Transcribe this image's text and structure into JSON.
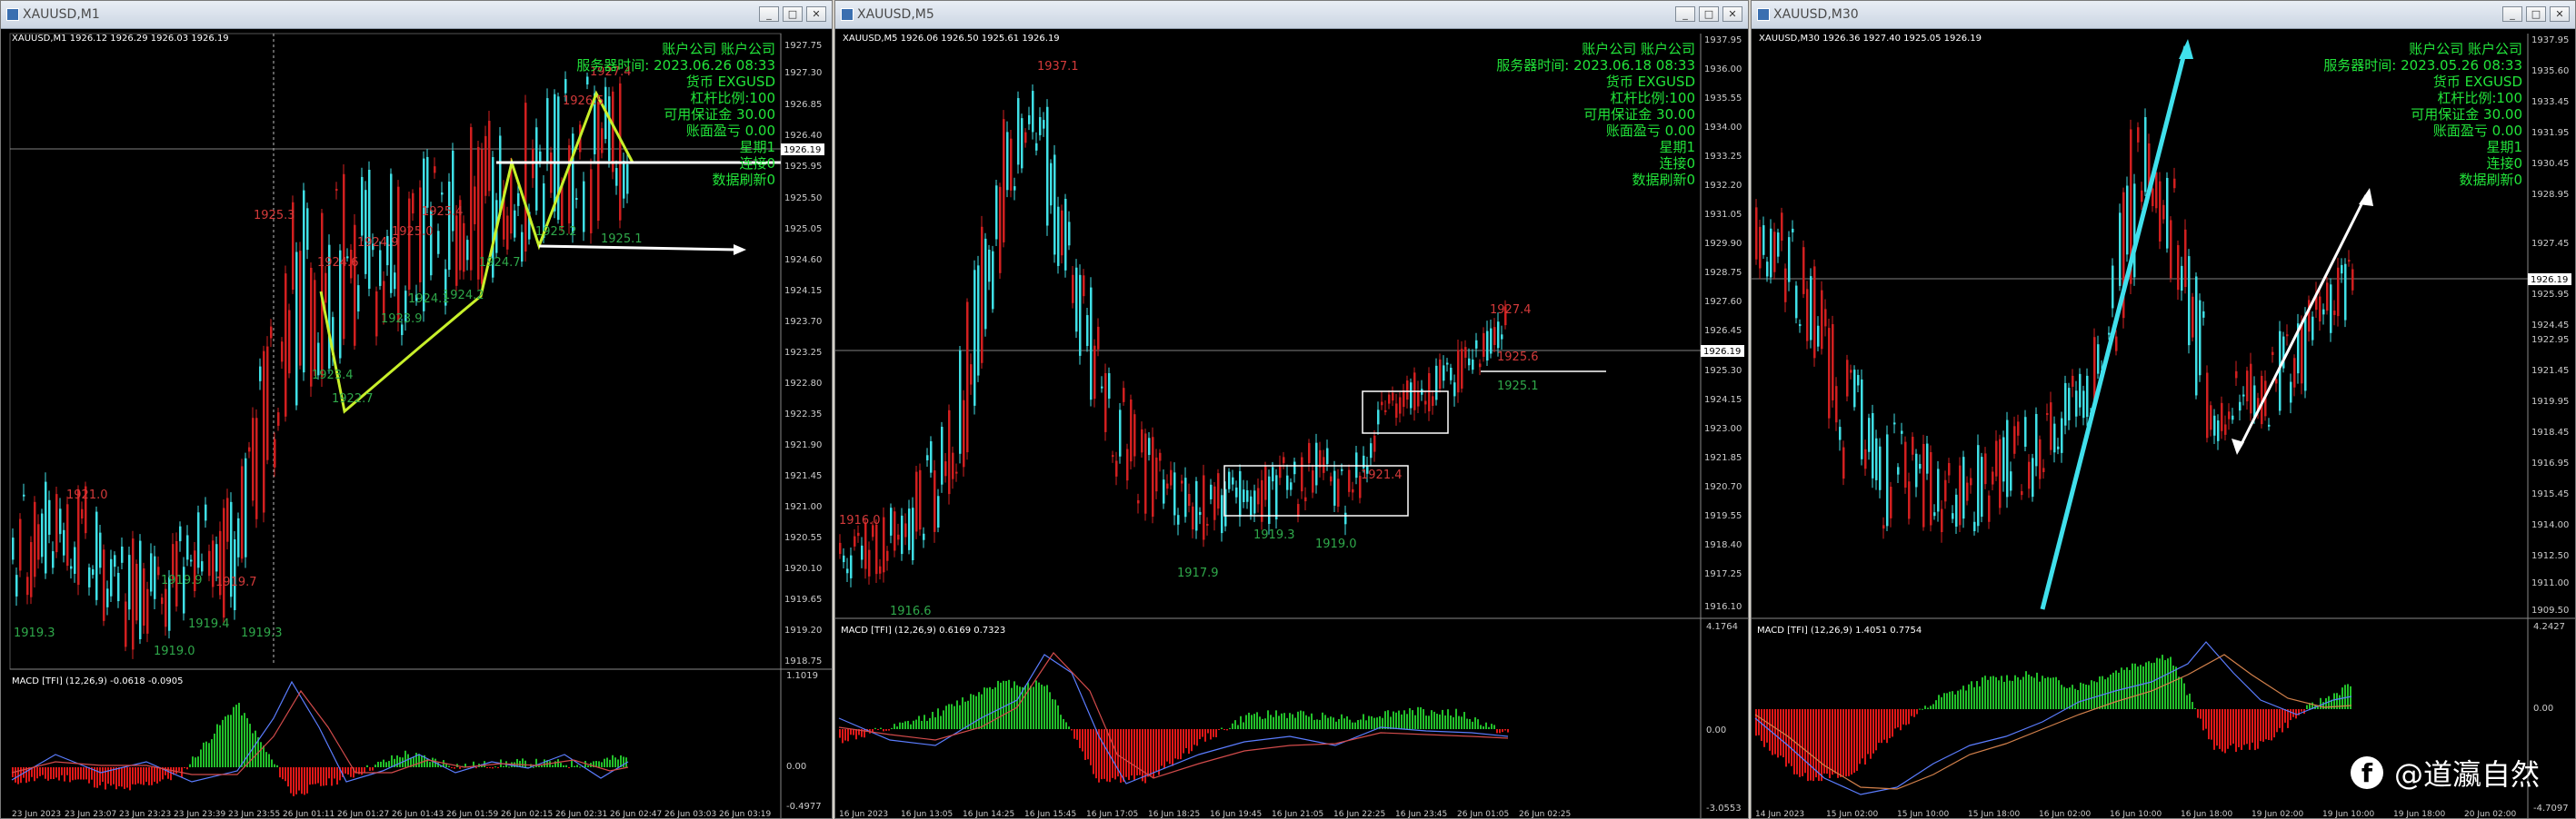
{
  "windows": [
    {
      "title": "XAUUSD,M1",
      "header": "XAUUSD,M1  1926.12 1926.29 1926.03 1926.19",
      "price_ticks": [
        "1927.75",
        "1927.30",
        "1926.85",
        "1926.40",
        "1925.95",
        "1925.50",
        "1925.05",
        "1924.60",
        "1924.15",
        "1923.70",
        "1923.25",
        "1922.80",
        "1922.35",
        "1921.90",
        "1921.45",
        "1921.00",
        "1920.55",
        "1920.10",
        "1919.65",
        "1919.20",
        "1918.75"
      ],
      "current_price": "1926.19",
      "macd_header": "MACD [TFI] (12,26,9) -0.0618 -0.0905",
      "macd_ticks": [
        "1.1019",
        "0.00",
        "-0.4977"
      ],
      "time_labels": [
        "23 Jun 2023",
        "23 Jun 23:07",
        "23 Jun 23:23",
        "23 Jun 23:39",
        "23 Jun 23:55",
        "26 Jun 01:11",
        "26 Jun 01:27",
        "26 Jun 01:43",
        "26 Jun 01:59",
        "26 Jun 02:15",
        "26 Jun 02:31",
        "26 Jun 02:47",
        "26 Jun 03:03",
        "26 Jun 03:19"
      ],
      "info": {
        "account": "账户公司 账户公司",
        "server_time": "服务器时间: 2023.06.26 08:33",
        "currency": "货币 EXGUSD",
        "leverage": "杠杆比例:100",
        "free_margin": "可用保证金 30.00",
        "equity": "账面盈亏 0.00",
        "week": "星期1",
        "connected": "连接0",
        "refresh": "数据刷新0"
      },
      "annotations": [
        "1925.3",
        "1924.6",
        "1924.9",
        "1925.0",
        "1925.4",
        "1923.4",
        "1922.7",
        "1923.9",
        "1924.1",
        "1924.2",
        "1924.7",
        "1925.2",
        "1925.1",
        "1926.5",
        "1927.4",
        "1921.0",
        "1919.3",
        "1919.9",
        "1919.4",
        "1919.0",
        "1919.7",
        "1919.3"
      ]
    },
    {
      "title": "XAUUSD,M5",
      "header": "XAUUSD,M5  1926.06 1926.50 1925.61 1926.19",
      "price_ticks": [
        "1937.95",
        "1936.00",
        "1935.55",
        "1934.00",
        "1933.25",
        "1932.20",
        "1931.05",
        "1929.90",
        "1928.75",
        "1927.60",
        "1926.45",
        "1925.30",
        "1924.15",
        "1923.00",
        "1921.85",
        "1920.70",
        "1919.55",
        "1918.40",
        "1917.25",
        "1916.10"
      ],
      "current_price": "1926.19",
      "macd_header": "MACD [TFI] (12,26,9) 0.6169 0.7323",
      "macd_ticks": [
        "4.1764",
        "0.00",
        "-3.0553"
      ],
      "time_labels": [
        "16 Jun 2023",
        "16 Jun 13:05",
        "16 Jun 14:25",
        "16 Jun 15:45",
        "16 Jun 17:05",
        "16 Jun 18:25",
        "16 Jun 19:45",
        "16 Jun 21:05",
        "16 Jun 22:25",
        "16 Jun 23:45",
        "26 Jun 01:05",
        "26 Jun 02:25"
      ],
      "info": {
        "account": "账户公司 账户公司",
        "server_time": "服务器时间: 2023.06.18 08:33",
        "currency": "货币 EXGUSD",
        "leverage": "杠杆比例:100",
        "free_margin": "可用保证金 30.00",
        "equity": "账面盈亏 0.00",
        "week": "星期1",
        "connected": "连接0",
        "refresh": "数据刷新0"
      },
      "annotations": [
        "1937.1",
        "1916.0",
        "1916.6",
        "1917.9",
        "1921.4",
        "1919.3",
        "1919.0",
        "1927.4",
        "1925.6",
        "1925.1"
      ]
    },
    {
      "title": "XAUUSD,M30",
      "header": "XAUUSD,M30  1926.36 1927.40 1925.05 1926.19",
      "price_ticks": [
        "1937.95",
        "1935.60",
        "1933.45",
        "1931.95",
        "1930.45",
        "1928.95",
        "1927.45",
        "1925.95",
        "1924.45",
        "1922.95",
        "1921.45",
        "1919.95",
        "1918.45",
        "1916.95",
        "1915.45",
        "1914.00",
        "1912.50",
        "1911.00",
        "1909.50"
      ],
      "current_price": "1926.19",
      "macd_header": "MACD [TFI] (12,26,9) 1.4051 0.7754",
      "macd_ticks": [
        "4.2427",
        "0.00",
        "-4.7097"
      ],
      "time_labels": [
        "14 Jun 2023",
        "15 Jun 02:00",
        "15 Jun 10:00",
        "15 Jun 18:00",
        "16 Jun 02:00",
        "16 Jun 10:00",
        "16 Jun 18:00",
        "19 Jun 02:00",
        "19 Jun 10:00",
        "19 Jun 18:00",
        "20 Jun 02:00"
      ],
      "info": {
        "account": "账户公司 账户公司",
        "server_time": "服务器时间: 2023.05.26 08:33",
        "currency": "货币 EXGUSD",
        "leverage": "杠杆比例:100",
        "free_margin": "可用保证金 30.00",
        "equity": "账面盈亏 0.00",
        "week": "星期1",
        "connected": "连接0",
        "refresh": "数据刷新0"
      },
      "annotations": []
    }
  ],
  "watermark": {
    "icon": "facebook-icon",
    "text": "@道瀛自然"
  },
  "colors": {
    "bull": "#3fe0e6",
    "bear": "#d21f1f",
    "info_text": "#22e43a",
    "macd_pos": "#22c02a",
    "macd_neg": "#e01818",
    "trend_m1": "#c8f02a",
    "trend_m30": "#40e0ec"
  }
}
